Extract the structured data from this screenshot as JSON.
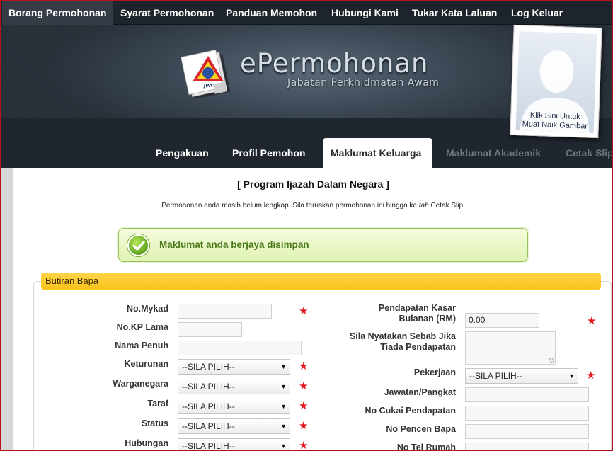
{
  "topnav": {
    "items": [
      {
        "label": "Borang Permohonan",
        "active": true
      },
      {
        "label": "Syarat Permohonan"
      },
      {
        "label": "Panduan Memohon"
      },
      {
        "label": "Hubungi Kami"
      },
      {
        "label": "Tukar Kata Laluan"
      },
      {
        "label": "Log Keluar"
      }
    ]
  },
  "header": {
    "brand_name": "ePermohonan",
    "brand_sub": "Jabatan Perkhidmatan Awam",
    "logo_text": "JPA"
  },
  "photo": {
    "caption_line1": "Klik Sini Untuk",
    "caption_line2": "Muat Naik Gambar"
  },
  "subtabs": [
    {
      "label": "Pengakuan"
    },
    {
      "label": "Profil Pemohon"
    },
    {
      "label": "Maklumat Keluarga",
      "active": true
    },
    {
      "label": "Maklumat Akademik",
      "disabled": true
    },
    {
      "label": "Cetak Slip",
      "disabled": true
    }
  ],
  "main": {
    "program_title": "[ Program Ijazah Dalam Negara ]",
    "notice_before": "Permohonan anda masih belum lengkap. Sila teruskan permohonan ini hingga ke ",
    "notice_tab": "tab",
    "notice_after": " Cetak Slip.",
    "success_message": "Maklumat anda berjaya disimpan",
    "panel_title": "Butiran Bapa"
  },
  "form_left": {
    "mykad_label": "No.Mykad",
    "kp_lama_label": "No.KP Lama",
    "nama_label": "Nama Penuh",
    "keturunan_label": "Keturunan",
    "warganegara_label": "Warganegara",
    "taraf_label": "Taraf",
    "status_label": "Status",
    "hubungan_label": "Hubungan",
    "select_default": "--SILA PILIH--",
    "mykad_value": "",
    "kp_lama_value": "",
    "nama_value": ""
  },
  "form_right": {
    "pendapatan_label_1": "Pendapatan Kasar",
    "pendapatan_label_2": "Bulanan (RM)",
    "pendapatan_value": "0.00",
    "sebab_label_1": "Sila Nyatakan Sebab Jika",
    "sebab_label_2": "Tiada Pendapatan",
    "pekerjaan_label": "Pekerjaan",
    "jawatan_label": "Jawatan/Pangkat",
    "cukai_label": "No Cukai Pendapatan",
    "pencen_label": "No Pencen Bapa",
    "tel_label": "No Tel Rumah",
    "select_default": "--SILA PILIH--"
  },
  "required_marker": "★",
  "dropdown_arrow": "▼",
  "colors": {
    "accent_yellow": "#f9c21c",
    "required_red": "#e3161c",
    "success_green": "#4b7a1b",
    "nav_bg": "#1e242b",
    "frame_red": "#b5121b"
  }
}
